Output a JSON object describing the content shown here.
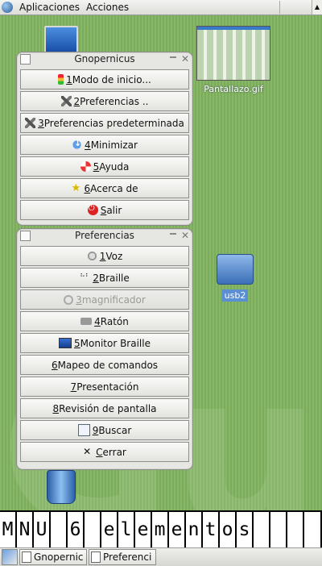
{
  "top_panel": {
    "menus": [
      "Aplicaciones",
      "Acciones"
    ]
  },
  "desktop": {
    "screenshot_file_label": "Pantallazo.gif",
    "usb_label": "usb2",
    "background_watermark": "Gula"
  },
  "gnopernicus_window": {
    "title": "Gnopernicus",
    "buttons": [
      {
        "mnemonic": "1",
        "label": " Modo de inicio...",
        "icon": "traffic-light-icon"
      },
      {
        "mnemonic": "2",
        "label": " Preferencias ..",
        "icon": "tools-icon"
      },
      {
        "mnemonic": "3",
        "label": " Preferencias predeterminada",
        "icon": "tools-icon"
      },
      {
        "mnemonic": "4",
        "label": " Minimizar",
        "icon": "minimize-arrow-icon"
      },
      {
        "mnemonic": "5",
        "label": " Ayuda",
        "icon": "lifebuoy-icon"
      },
      {
        "mnemonic": "6",
        "label": " Acerca de",
        "icon": "star-icon"
      },
      {
        "mnemonic": "S",
        "label": "alir",
        "icon": "power-icon"
      }
    ]
  },
  "preferencias_window": {
    "title": "Preferencias",
    "buttons": [
      {
        "mnemonic": "1",
        "label": " Voz",
        "icon": "speaker-icon",
        "enabled": true
      },
      {
        "mnemonic": "2",
        "label": " Braille",
        "icon": "braille-icon",
        "enabled": true
      },
      {
        "mnemonic": "3",
        "label": " magnificador",
        "icon": "magnifier-icon",
        "enabled": false
      },
      {
        "mnemonic": "4",
        "label": " Ratón",
        "icon": "mouse-icon",
        "enabled": true
      },
      {
        "mnemonic": "5",
        "label": " Monitor Braille",
        "icon": "monitor-icon",
        "enabled": true
      },
      {
        "mnemonic": "6",
        "label": " Mapeo de comandos",
        "icon": "",
        "enabled": true
      },
      {
        "mnemonic": "7",
        "label": " Presentación",
        "icon": "",
        "enabled": true
      },
      {
        "mnemonic": "8",
        "label": " Revisión de pantalla",
        "icon": "",
        "enabled": true
      },
      {
        "mnemonic": "9",
        "label": " Buscar",
        "icon": "search-icon",
        "enabled": true
      },
      {
        "mnemonic": "C",
        "label": "errar",
        "icon": "close-x-icon",
        "enabled": true
      }
    ]
  },
  "braille_monitor": {
    "cells": [
      "M",
      "N",
      "U",
      " ",
      "6",
      " ",
      "e",
      "l",
      "e",
      "m",
      "e",
      "n",
      "t",
      "o",
      "s",
      " ",
      ""
    ]
  },
  "taskbar": {
    "tasks": [
      "Gnopernic",
      "Preferenci"
    ]
  }
}
